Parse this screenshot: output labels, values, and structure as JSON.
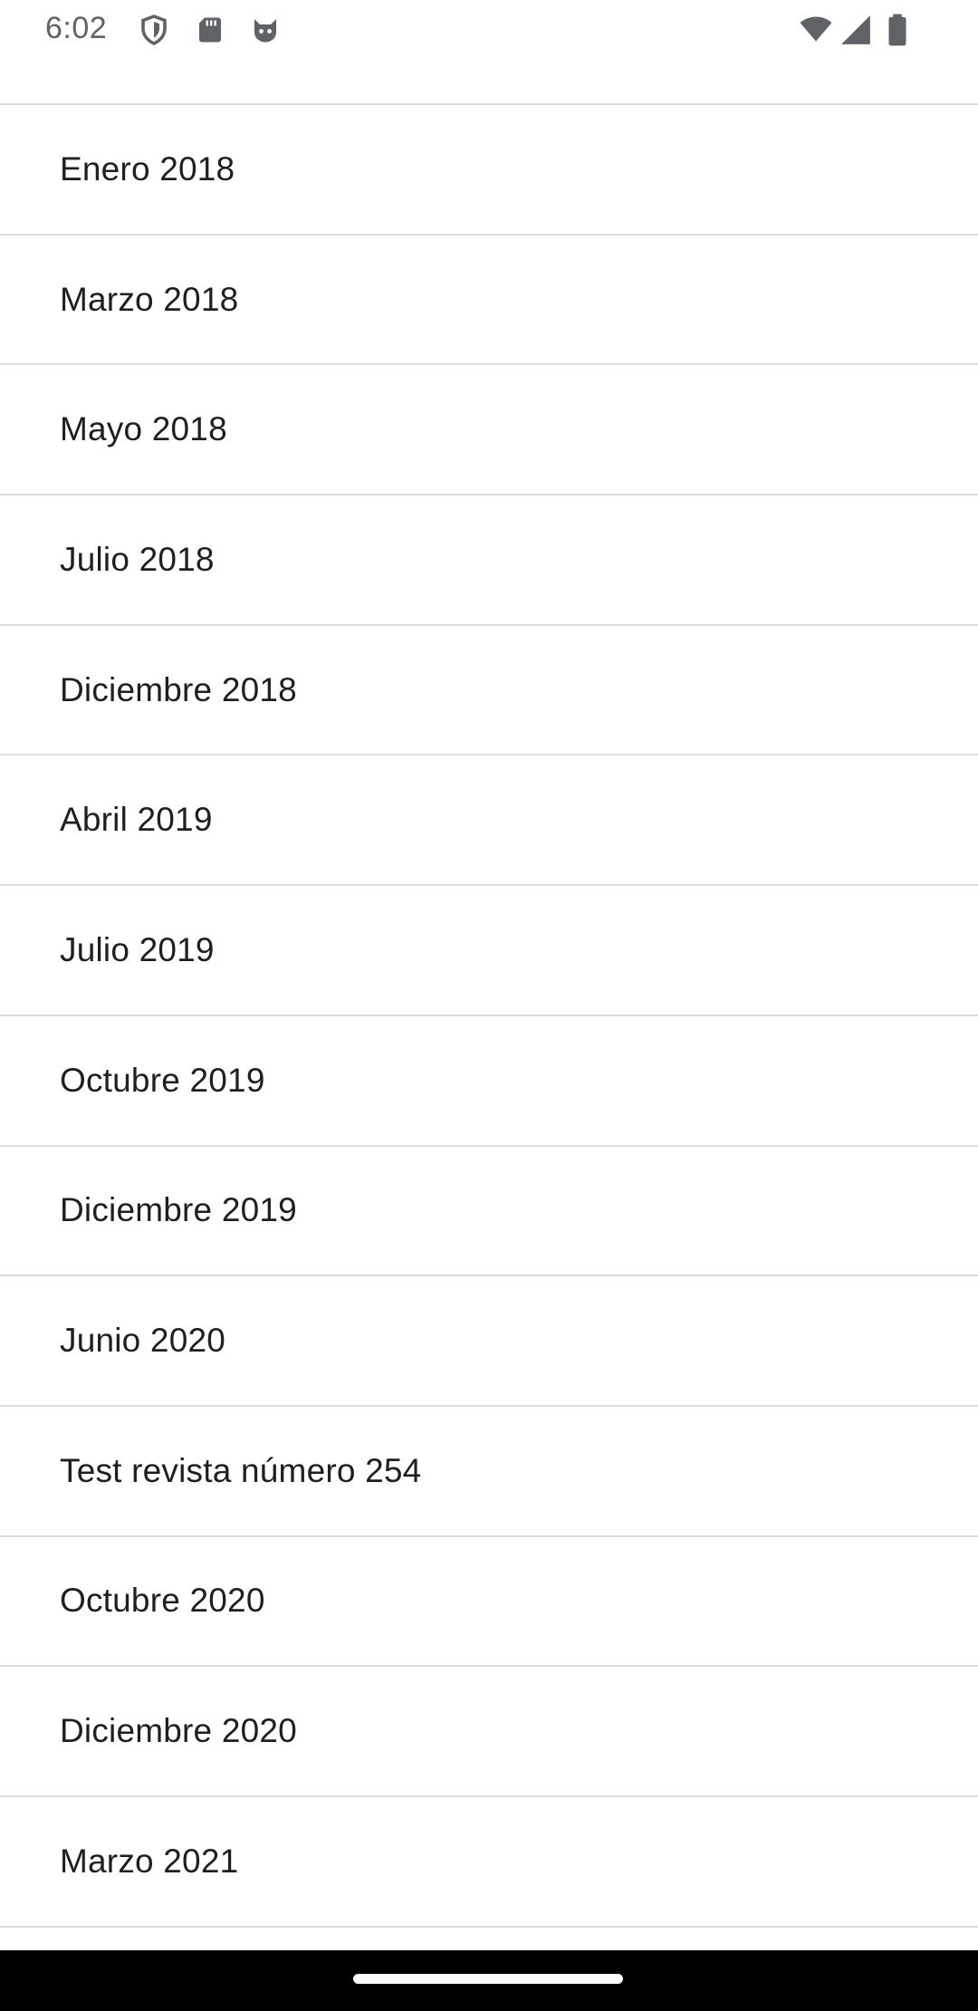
{
  "status_bar": {
    "time": "6:02",
    "left_icons": [
      "shield-icon",
      "sd-card-icon",
      "cat-icon"
    ],
    "right_icons": [
      "wifi-icon",
      "cell-signal-icon",
      "battery-icon"
    ]
  },
  "list": {
    "items": [
      {
        "label": "Enero 2018"
      },
      {
        "label": "Marzo 2018"
      },
      {
        "label": "Mayo 2018"
      },
      {
        "label": "Julio 2018"
      },
      {
        "label": "Diciembre 2018"
      },
      {
        "label": "Abril 2019"
      },
      {
        "label": "Julio 2019"
      },
      {
        "label": "Octubre 2019"
      },
      {
        "label": "Diciembre 2019"
      },
      {
        "label": "Junio 2020"
      },
      {
        "label": "Test revista número 254"
      },
      {
        "label": "Octubre 2020"
      },
      {
        "label": "Diciembre 2020"
      },
      {
        "label": "Marzo 2021"
      }
    ]
  },
  "colors": {
    "divider": "#dcdcdc",
    "text": "#1f1f1f",
    "status_text": "#5f6368",
    "nav_bar": "#000000"
  }
}
